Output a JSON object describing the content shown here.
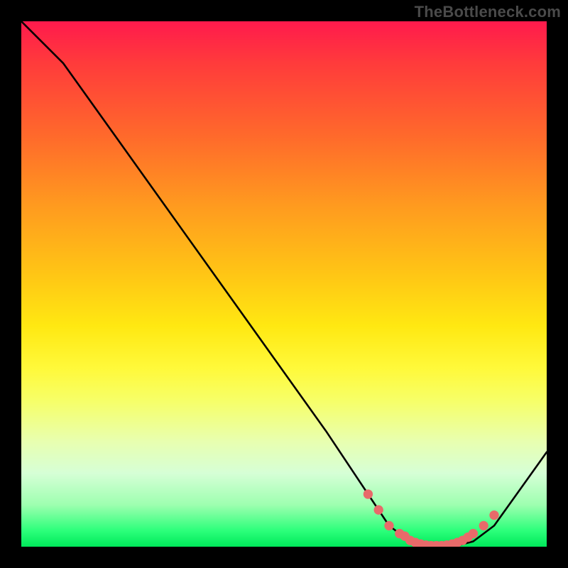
{
  "watermark": "TheBottleneck.com",
  "chart_data": {
    "type": "line",
    "title": "",
    "xlabel": "",
    "ylabel": "",
    "xlim": [
      0,
      100
    ],
    "ylim": [
      0,
      100
    ],
    "grid": false,
    "legend": false,
    "series": [
      {
        "name": "bottleneck-curve",
        "x": [
          0,
          8,
          18,
          28,
          38,
          48,
          58,
          66,
          70,
          74,
          78,
          82,
          86,
          90,
          100
        ],
        "y": [
          100,
          92,
          78,
          64,
          50,
          36,
          22,
          10,
          4,
          1,
          0,
          0,
          1,
          4,
          18
        ]
      }
    ],
    "markers": {
      "name": "optimal-zone-points",
      "color": "#e86a6a",
      "x": [
        66,
        68,
        70,
        72,
        73,
        74,
        75,
        76,
        77,
        78,
        79,
        80,
        81,
        82,
        83,
        84,
        85,
        86,
        88,
        90
      ],
      "y": [
        10,
        7,
        4,
        2.5,
        2,
        1.2,
        0.8,
        0.5,
        0.3,
        0.2,
        0.2,
        0.2,
        0.3,
        0.5,
        0.8,
        1.2,
        1.8,
        2.5,
        4,
        6
      ]
    },
    "background_gradient": {
      "direction": "vertical",
      "stops": [
        {
          "pos": 0.0,
          "color": "#ff1a4d"
        },
        {
          "pos": 0.5,
          "color": "#ffe812"
        },
        {
          "pos": 1.0,
          "color": "#00e85a"
        }
      ]
    }
  }
}
